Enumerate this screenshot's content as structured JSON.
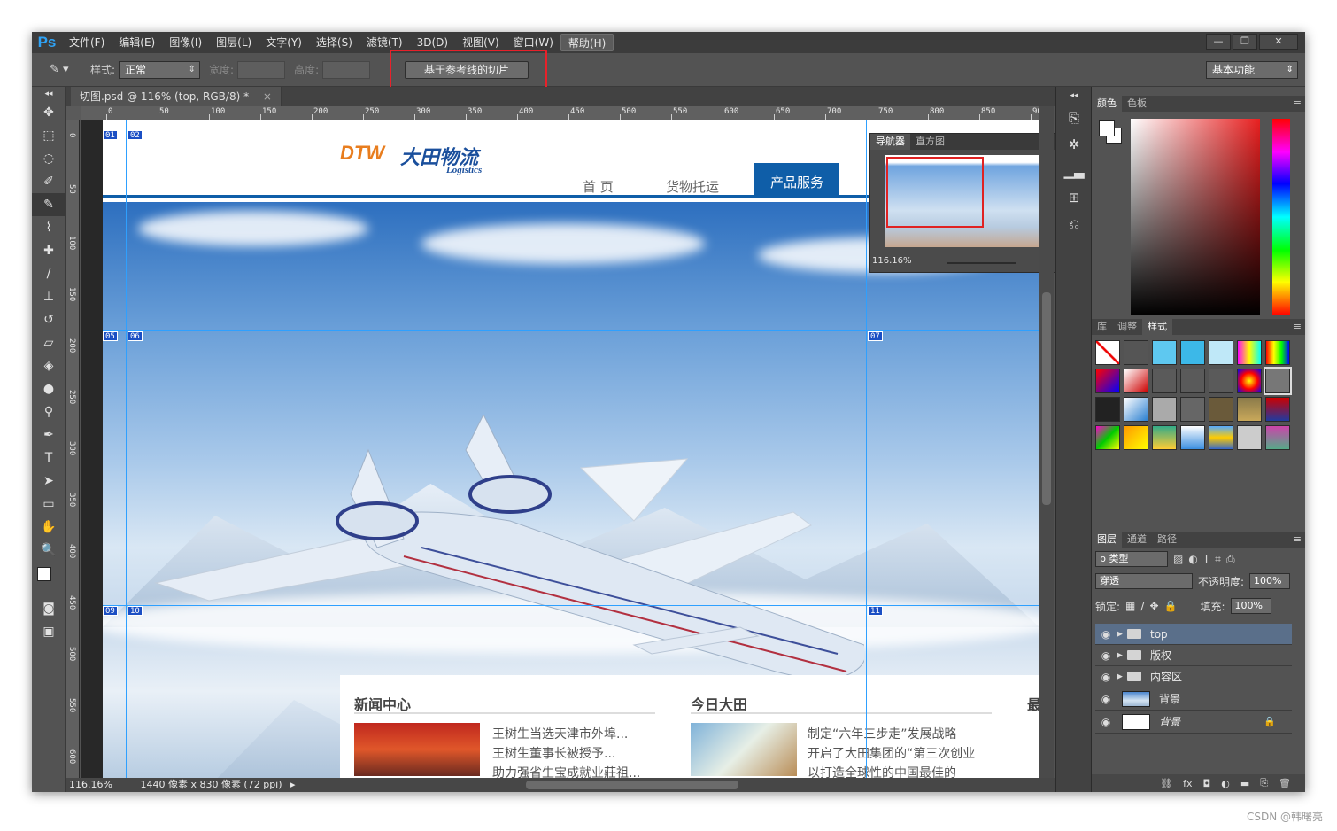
{
  "app": {
    "logo": "Ps"
  },
  "menu": [
    "文件(F)",
    "编辑(E)",
    "图像(I)",
    "图层(L)",
    "文字(Y)",
    "选择(S)",
    "滤镜(T)",
    "3D(D)",
    "视图(V)",
    "窗口(W)",
    "帮助(H)"
  ],
  "window_controls": [
    "—",
    "❐",
    "✕"
  ],
  "options": {
    "style_label": "样式:",
    "style_value": "正常",
    "width_label": "宽度:",
    "height_label": "高度:",
    "slice_button": "基于参考线的切片",
    "workspace": "基本功能"
  },
  "document": {
    "tab_title": "切图.psd @ 116% (top, RGB/8) *",
    "close": "×"
  },
  "ruler_h": [
    "0",
    "50",
    "100",
    "150",
    "200",
    "250",
    "300",
    "350",
    "400",
    "450",
    "500",
    "550",
    "600",
    "650",
    "700",
    "750",
    "800",
    "850",
    "90"
  ],
  "ruler_v": [
    "0",
    "50",
    "100",
    "150",
    "200",
    "250",
    "300",
    "350",
    "400",
    "450",
    "500",
    "550",
    "600"
  ],
  "website": {
    "logo_en": "DTW",
    "logo_cn": "大田物流",
    "logo_sub": "Logistics",
    "nav": [
      "首 页",
      "货物托运"
    ],
    "nav_active": "产品服务",
    "news_title": "新闻中心",
    "news_items": [
      "王树生当选天津市外埠...",
      "王树生董事长被授予...",
      "助力强省生宝成就业莊祖..."
    ],
    "today_title": "今日大田",
    "today_items": [
      "制定“六年三步走”发展战略",
      "开启了大田集团的“第三次创业",
      "以打造全球性的中国最佳的"
    ],
    "third_title": "最"
  },
  "slices": [
    "01",
    "02",
    "05",
    "06",
    "07",
    "09",
    "10",
    "11"
  ],
  "navigator": {
    "tabs": [
      "导航器",
      "直方图"
    ],
    "zoom": "116.16%"
  },
  "status": {
    "zoom": "116.16%",
    "doc_info": "1440 像素 x 830 像素 (72 ppi)"
  },
  "color_panel": {
    "tabs": [
      "颜色",
      "色板"
    ]
  },
  "styles_panel": {
    "tabs": [
      "库",
      "调整",
      "样式"
    ]
  },
  "layers_panel": {
    "tabs": [
      "图层",
      "通道",
      "路径"
    ],
    "filter": "ρ 类型",
    "blend_mode": "穿透",
    "opacity_label": "不透明度:",
    "opacity": "100%",
    "lock_label": "锁定:",
    "fill_label": "填充:",
    "fill": "100%",
    "layers": [
      {
        "name": "top",
        "type": "group",
        "selected": true
      },
      {
        "name": "版权",
        "type": "group"
      },
      {
        "name": "内容区",
        "type": "group"
      },
      {
        "name": "背景",
        "type": "image"
      },
      {
        "name": "背景",
        "type": "locked"
      }
    ],
    "footer_icons": [
      "link-icon",
      "fx-icon",
      "mask-icon",
      "adjustment-icon",
      "folder-icon",
      "new-layer-icon",
      "trash-icon"
    ]
  },
  "watermark": "CSDN @韩曙亮",
  "colors": {
    "accent_red": "#e8212a",
    "guide": "#2ea0ff",
    "site_blue": "#0f5ea8",
    "ps_blue": "#2fa3f6"
  }
}
